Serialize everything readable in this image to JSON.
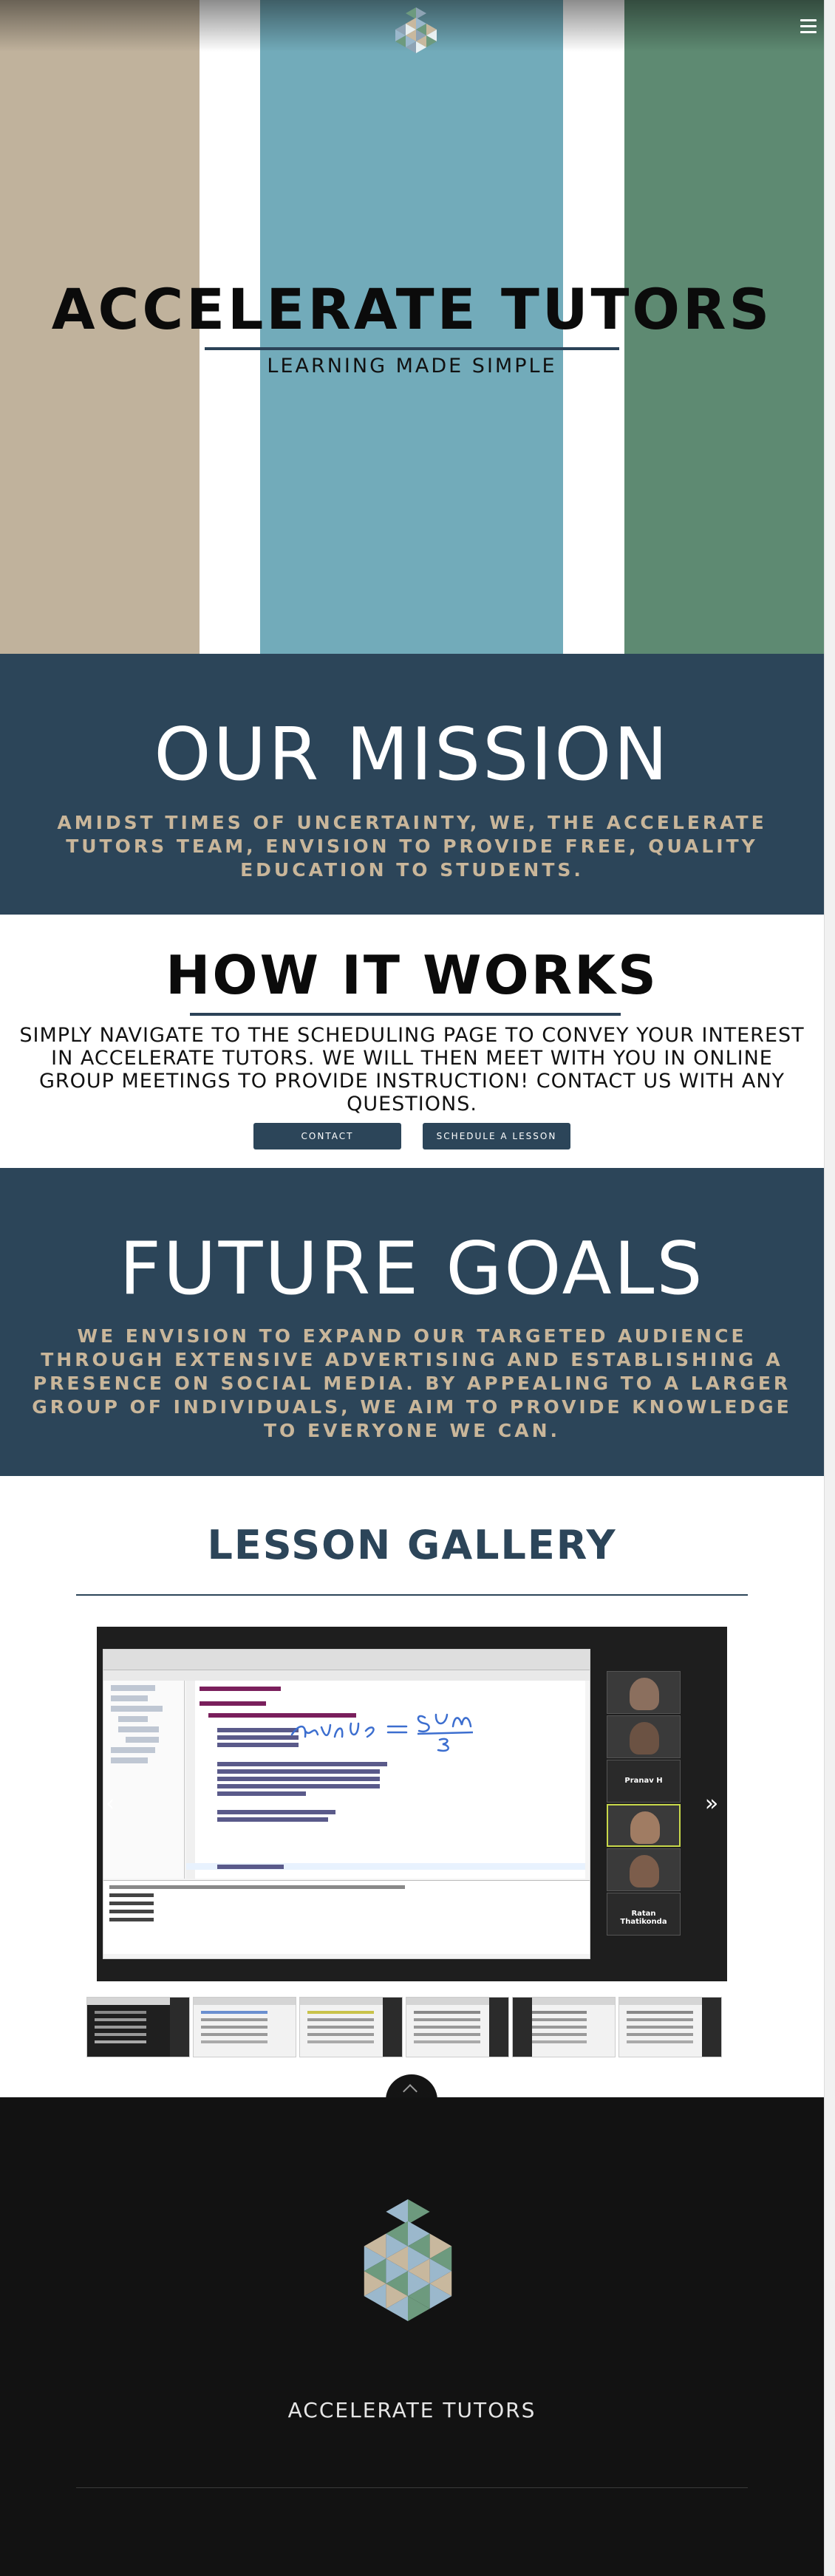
{
  "hero": {
    "title": "ACCELERATE TUTORS",
    "subtitle": "LEARNING MADE SIMPLE",
    "stripe_colors": [
      "#c0b29c",
      "#ffffff",
      "#72abba",
      "#ffffff",
      "#5e8a72"
    ],
    "menu_icon": "hamburger-menu-icon"
  },
  "mission": {
    "heading": "OUR MISSION",
    "text": "AMIDST TIMES OF UNCERTAINTY, WE, THE ACCELERATE TUTORS TEAM, ENVISION TO PROVIDE FREE, QUALITY EDUCATION TO STUDENTS."
  },
  "how": {
    "heading": "HOW IT WORKS",
    "text": "SIMPLY NAVIGATE TO THE SCHEDULING PAGE TO CONVEY YOUR INTEREST IN ACCELERATE TUTORS. WE WILL THEN MEET WITH YOU IN ONLINE GROUP MEETINGS TO PROVIDE INSTRUCTION! CONTACT US WITH ANY QUESTIONS.",
    "contact_label": "CONTACT",
    "schedule_label": "SCHEDULE A LESSON"
  },
  "goals": {
    "heading": "FUTURE GOALS",
    "text": "WE ENVISION TO EXPAND OUR TARGETED AUDIENCE THROUGH EXTENSIVE ADVERTISING AND ESTABLISHING A PRESENCE ON SOCIAL MEDIA. BY APPEALING TO A LARGER GROUP OF INDIVIDUALS, WE AIM TO PROVIDE KNOWLEDGE TO EVERYONE WE CAN."
  },
  "gallery": {
    "heading": "LESSON GALLERY",
    "prev_icon": "‹",
    "next_icon": "»",
    "participants": [
      "",
      "",
      "Pranav H",
      "",
      "",
      "Ratan Thatikonda"
    ],
    "thumbnail_count": 6
  },
  "footer": {
    "title": "ACCELERATE TUTORS"
  },
  "colors": {
    "navy": "#2c4559",
    "tan": "#c9b69a",
    "footer_bg": "#121212"
  }
}
